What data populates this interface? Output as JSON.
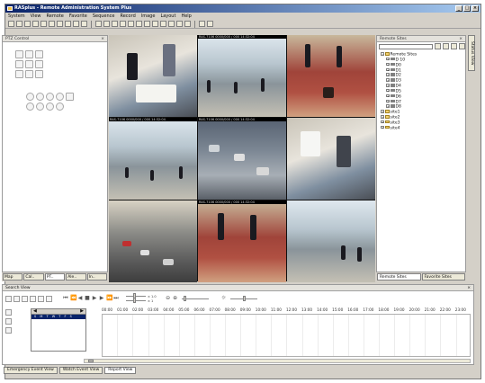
{
  "window": {
    "title": "RASplus - Remote Administration System Plus",
    "controls": [
      "_",
      "□",
      "×"
    ]
  },
  "menu": [
    "System",
    "View",
    "Remote",
    "Favorite",
    "Sequence",
    "Record",
    "Image",
    "Layout",
    "Help"
  ],
  "ptz_panel": {
    "title": "PTZ Control",
    "close": "×"
  },
  "left_tabs": [
    "Map",
    "Cal..",
    "PT..",
    "Ale..",
    "In.."
  ],
  "video": {
    "cells": [
      {
        "label": "",
        "scene": "office"
      },
      {
        "label": "RAS-7106 0000/000 / 000 14:32:04",
        "scene": "station"
      },
      {
        "label": "",
        "scene": "lobby"
      },
      {
        "label": "RAS-7106 0000/000 / 000 14:32:04",
        "scene": "station"
      },
      {
        "label": "RAS-7106 0000/000 / 000 14:32:04",
        "scene": "parking"
      },
      {
        "label": "",
        "scene": "office"
      },
      {
        "label": "",
        "scene": "road"
      },
      {
        "label": "RAS-7106 0000/000 / 000 14:32:04",
        "scene": "lobby"
      },
      {
        "label": "",
        "scene": "station"
      }
    ]
  },
  "sites_panel": {
    "title": "Remote Sites",
    "close": "×",
    "tree": [
      {
        "label": "Remote Sites",
        "level": 0,
        "icon": "folder"
      },
      {
        "label": "D 10",
        "level": 1,
        "icon": "camera"
      },
      {
        "label": "D0",
        "level": 1,
        "icon": "camera"
      },
      {
        "label": "D1",
        "level": 1,
        "icon": "camera"
      },
      {
        "label": "D2",
        "level": 1,
        "icon": "camera"
      },
      {
        "label": "D3",
        "level": 1,
        "icon": "camera"
      },
      {
        "label": "D4",
        "level": 1,
        "icon": "camera"
      },
      {
        "label": "D5",
        "level": 1,
        "icon": "camera"
      },
      {
        "label": "D6",
        "level": 1,
        "icon": "camera"
      },
      {
        "label": "D7",
        "level": 1,
        "icon": "camera"
      },
      {
        "label": "D8",
        "level": 1,
        "icon": "camera"
      },
      {
        "label": "site1",
        "level": 0,
        "icon": "folder"
      },
      {
        "label": "site2",
        "level": 0,
        "icon": "folder"
      },
      {
        "label": "site3",
        "level": 0,
        "icon": "folder"
      },
      {
        "label": "site4",
        "level": 0,
        "icon": "folder"
      }
    ],
    "tabs": [
      "Remote Sites",
      "Favorite Sites"
    ]
  },
  "status_view": {
    "label": "Status View"
  },
  "search_view": {
    "title": "Search View",
    "close": "×",
    "zoom_top": "× 1.0",
    "zoom_bottom": "× 1",
    "calendar_days": "S M T W T F S",
    "hours": [
      "00:00",
      "01:00",
      "02:00",
      "03:00",
      "04:00",
      "05:00",
      "06:00",
      "07:00",
      "08:00",
      "09:00",
      "10:00",
      "11:00",
      "12:00",
      "13:00",
      "14:00",
      "15:00",
      "16:00",
      "17:00",
      "18:00",
      "19:00",
      "20:00",
      "21:00",
      "22:00",
      "23:00"
    ]
  },
  "bottom_tabs": [
    "Emergency Event View",
    "Watch Event View",
    "Report View"
  ]
}
